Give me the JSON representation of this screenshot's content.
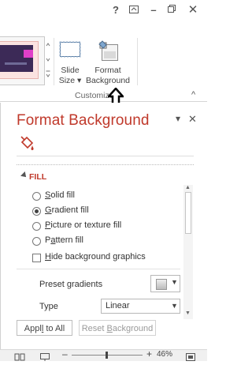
{
  "titlebar": {
    "help": "?",
    "restore_ribbon": "⊼",
    "minimize": "–",
    "close": "✕"
  },
  "ribbon": {
    "slide_size": {
      "line1": "Slide",
      "line2": "Size ▾"
    },
    "format_background": {
      "line1": "Format",
      "line2": "Background"
    },
    "group_label": "Customize",
    "collapse": "^"
  },
  "pane": {
    "title": "Format Background",
    "menu": "▾",
    "close": "✕",
    "section": "FILL",
    "options": [
      {
        "label": "Solid fill",
        "checked": false
      },
      {
        "label": "Gradient fill",
        "checked": true
      },
      {
        "label": "Picture or texture fill",
        "checked": false
      },
      {
        "label": "Pattern fill",
        "checked": false
      }
    ],
    "hide_graphics": "Hide background graphics",
    "preset_gradients": "Preset gradients",
    "type_label": "Type",
    "type_value": "Linear",
    "apply_all": "Apply to All",
    "reset": "Reset Background"
  },
  "statusbar": {
    "minus": "–",
    "plus": "+",
    "zoom": "46%"
  }
}
